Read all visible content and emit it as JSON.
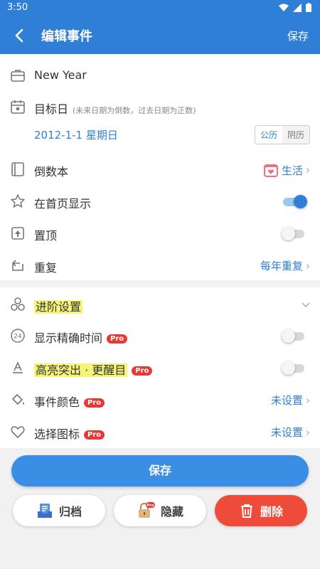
{
  "status": {
    "time": "3:50"
  },
  "appbar": {
    "title": "编辑事件",
    "save_label": "保存"
  },
  "event": {
    "name": "New Year",
    "target_label": "目标日",
    "target_hint": "(未来日期为倒数，过去日期为正数)",
    "date": "2012-1-1 星期日",
    "calendar_options": [
      "公历",
      "阴历"
    ],
    "calendar_selected": "公历"
  },
  "rows": {
    "book_label": "倒数本",
    "book_value": "生活",
    "home_label": "在首页显示",
    "home_on": true,
    "pin_label": "置顶",
    "pin_on": false,
    "repeat_label": "重复",
    "repeat_value": "每年重复"
  },
  "advanced": {
    "title": "进阶设置",
    "precise_label": "显示精确时间",
    "precise_on": false,
    "highlight_label": "高亮突出 · 更醒目",
    "highlight_on": false,
    "color_label": "事件颜色",
    "color_value": "未设置",
    "icon_label": "选择图标",
    "icon_value": "未设置",
    "pro_badge": "Pro"
  },
  "actions": {
    "save": "保存",
    "archive": "归档",
    "hide": "隐藏",
    "delete": "删除"
  },
  "colors": {
    "primary": "#2f7fd6",
    "danger": "#ef4b3a",
    "highlight": "#f6f476"
  }
}
